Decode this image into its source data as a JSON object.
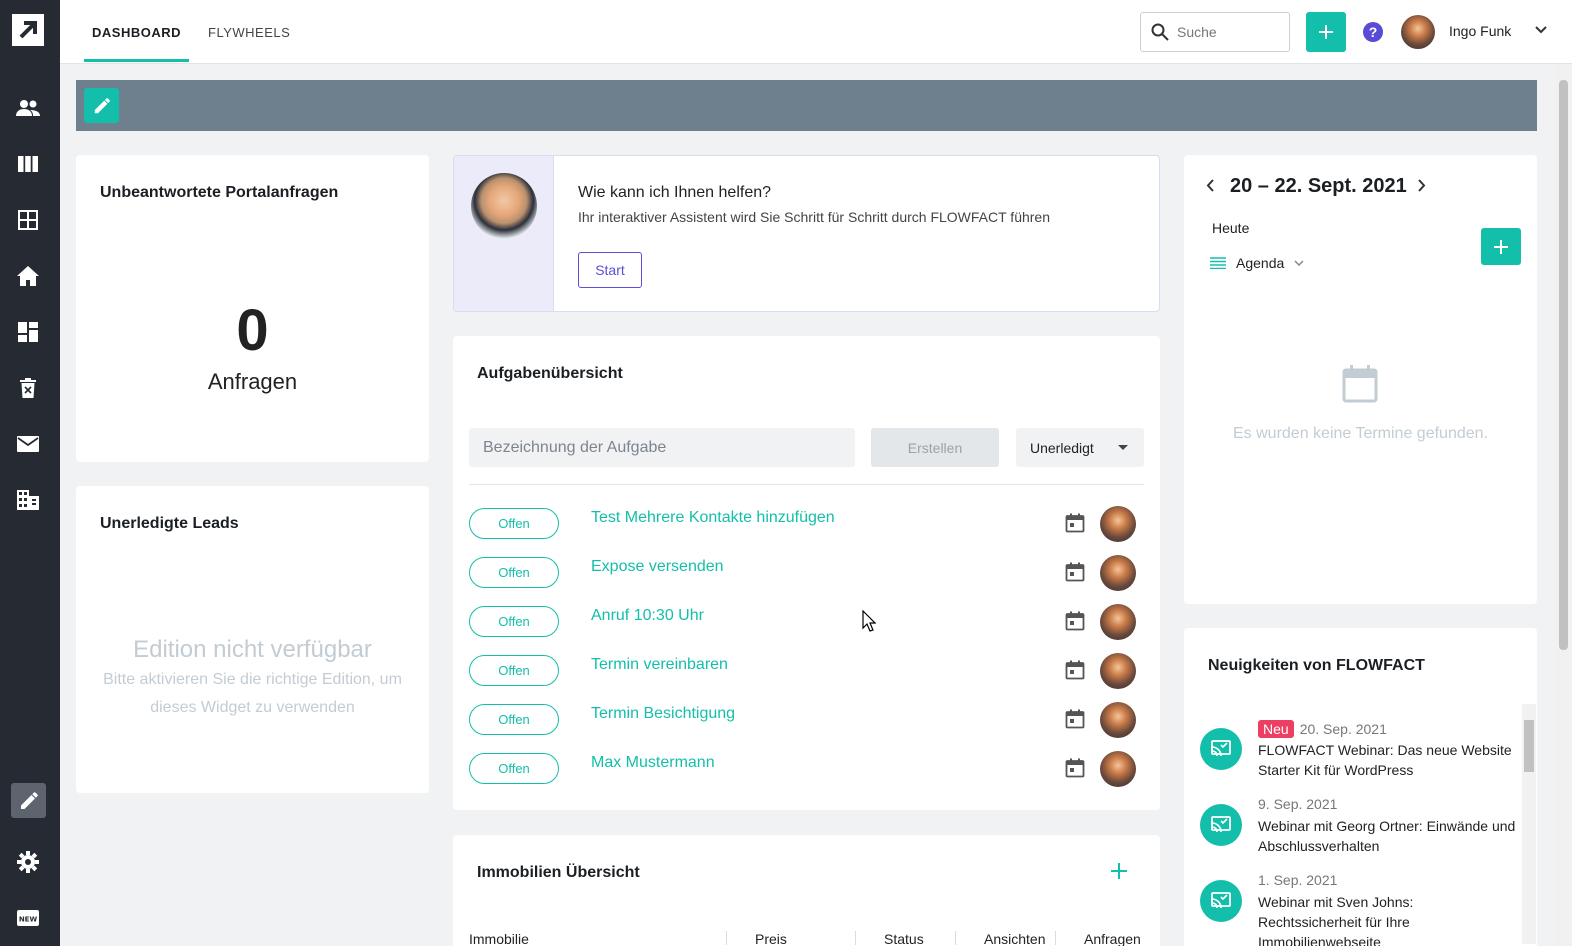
{
  "nav": {
    "tabs": [
      {
        "label": "DASHBOARD",
        "active": true
      },
      {
        "label": "FLYWHEELS",
        "active": false
      }
    ]
  },
  "header": {
    "search_placeholder": "Suche",
    "user_name": "Ingo Funk",
    "help_symbol": "?"
  },
  "sidebar_icons": [
    "users-icon",
    "columns-icon",
    "grid-icon",
    "home-icon",
    "dashboard-icon",
    "trash-icon",
    "mail-icon",
    "building-icon",
    "edit-icon",
    "settings-icon",
    "new-icon"
  ],
  "portal": {
    "title": "Unbeantwortete Portalanfragen",
    "count": "0",
    "count_label": "Anfragen"
  },
  "leads": {
    "title": "Unerledigte Leads",
    "unavailable_title": "Edition nicht verfügbar",
    "unavailable_text": "Bitte aktivieren Sie die richtige Edition, um dieses Widget zu verwenden"
  },
  "assistant": {
    "title": "Wie kann ich Ihnen helfen?",
    "text": "Ihr interaktiver Assistent wird Sie Schritt für Schritt durch FLOWFACT führen",
    "start_label": "Start"
  },
  "tasks": {
    "title": "Aufgabenübersicht",
    "input_placeholder": "Bezeichnung der Aufgabe",
    "create_label": "Erstellen",
    "filter_value": "Unerledigt",
    "items": [
      {
        "status": "Offen",
        "name": "Test Mehrere Kontakte hinzufügen"
      },
      {
        "status": "Offen",
        "name": "Expose versenden"
      },
      {
        "status": "Offen",
        "name": "Anruf 10:30 Uhr"
      },
      {
        "status": "Offen",
        "name": "Termin vereinbaren"
      },
      {
        "status": "Offen",
        "name": "Termin Besichtigung"
      },
      {
        "status": "Offen",
        "name": "Max Mustermann"
      }
    ]
  },
  "immobilien": {
    "title": "Immobilien Übersicht",
    "columns": [
      "Immobilie",
      "Preis",
      "Status",
      "Ansichten",
      "Anfragen"
    ]
  },
  "calendar": {
    "range": "20 – 22. Sept. 2021",
    "today_label": "Heute",
    "view_label": "Agenda",
    "empty_text": "Es wurden keine Termine gefunden."
  },
  "news": {
    "title": "Neuigkeiten von FLOWFACT",
    "items": [
      {
        "badge": "Neu",
        "date": "20. Sep. 2021",
        "text": "FLOWFACT Webinar: Das neue Website Starter Kit für WordPress"
      },
      {
        "badge": "",
        "date": "9. Sep. 2021",
        "text": "Webinar mit Georg Ortner: Einwände und Abschlussverhalten"
      },
      {
        "badge": "",
        "date": "1. Sep. 2021",
        "text": "Webinar mit Sven Johns: Rechtssicherheit für Ihre Immobilienwebseite"
      }
    ]
  },
  "colors": {
    "accent": "#13bfaa",
    "sidebar": "#262b33",
    "editbar": "#6e808d",
    "badge": "#ec3f62",
    "assistant": "#5b4fd4"
  }
}
